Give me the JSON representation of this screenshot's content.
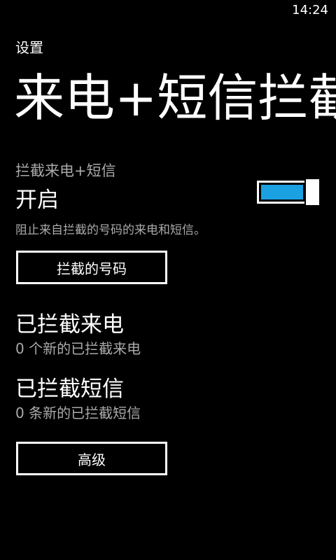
{
  "status_bar": {
    "time": "14:24"
  },
  "header": {
    "app_name": "设置",
    "page_title": "来电+短信拦截"
  },
  "block_toggle": {
    "header": "拦截来电+短信",
    "state_label": "开启",
    "is_on": true,
    "description": "阻止来自拦截的号码的来电和短信。"
  },
  "buttons": {
    "blocked_numbers": "拦截的号码",
    "advanced": "高级"
  },
  "blocked_calls": {
    "title": "已拦截来电",
    "subtitle": "0 个新的已拦截来电"
  },
  "blocked_sms": {
    "title": "已拦截短信",
    "subtitle": "0 条新的已拦截短信"
  },
  "colors": {
    "accent": "#1ba1e2",
    "background": "#000000",
    "foreground": "#ffffff",
    "subtle": "#aaaaaa"
  }
}
